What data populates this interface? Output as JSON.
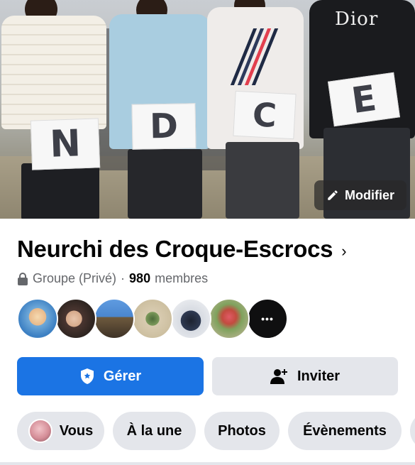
{
  "cover": {
    "signs": [
      "N",
      "D",
      "C",
      "E"
    ],
    "shirt_text": "Dior",
    "edit_label": "Modifier",
    "edit_icon": "pencil-icon"
  },
  "group": {
    "name": "Neurchi des Croque-Escrocs",
    "chevron": "›",
    "privacy": "Groupe (Privé)",
    "separator": "·",
    "member_count": "980",
    "member_label": "membres"
  },
  "members_more": "•••",
  "actions": {
    "manage_label": "Gérer",
    "manage_icon": "shield-icon",
    "invite_label": "Inviter",
    "invite_icon": "add-person-icon"
  },
  "tabs": [
    {
      "label": "Vous"
    },
    {
      "label": "À la une"
    },
    {
      "label": "Photos"
    },
    {
      "label": "Évènements"
    }
  ],
  "colors": {
    "primary": "#1b74e4",
    "secondary_bg": "#e4e6eb",
    "text": "#050505",
    "muted": "#65676b"
  }
}
